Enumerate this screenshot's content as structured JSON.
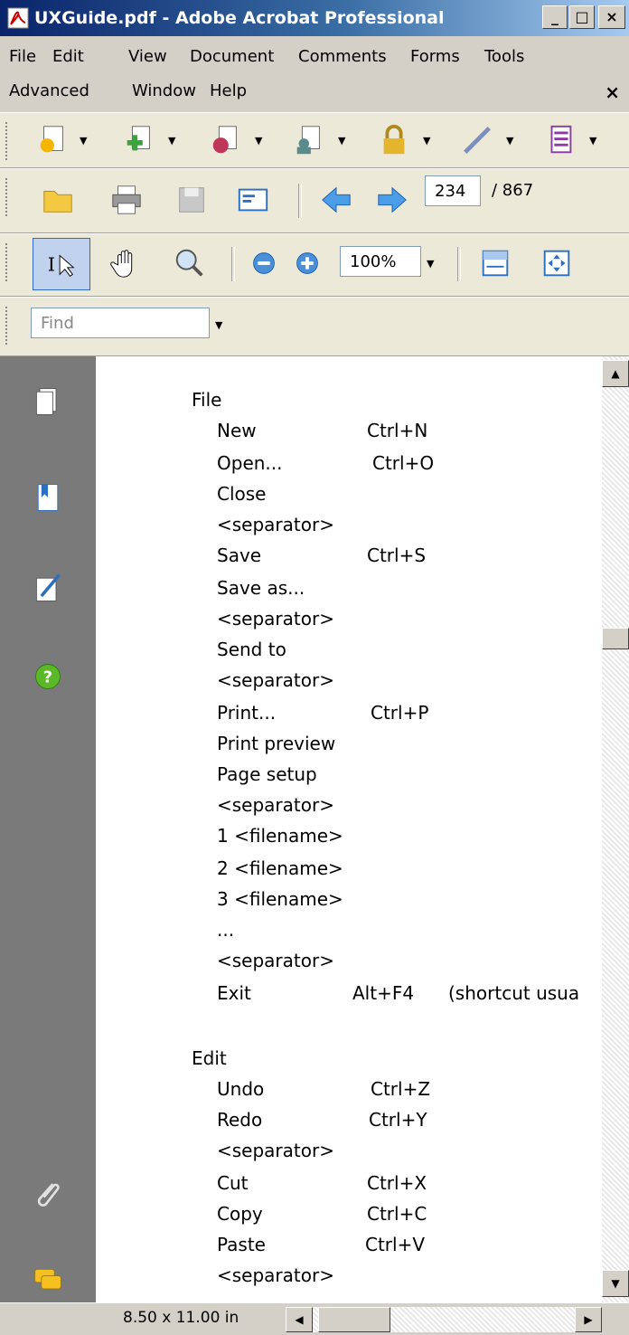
{
  "window": {
    "title": "UXGuide.pdf - Adobe Acrobat Professional",
    "minimize": "_",
    "maximize": "□",
    "close": "×"
  },
  "menu": {
    "items": [
      "File",
      "Edit",
      "View",
      "Document",
      "Comments",
      "Forms",
      "Tools",
      "Advanced",
      "Window",
      "Help"
    ],
    "close_doc": "×"
  },
  "toolbar": {
    "page_current": "234",
    "page_total": "/ 867",
    "zoom": "100%",
    "find_placeholder": "Find"
  },
  "document": {
    "lines": [
      "File",
      "New",
      "Ctrl+N",
      "Open...",
      "Ctrl+O",
      "Close",
      "<separator>",
      "Save",
      "Ctrl+S",
      "Save as...",
      "<separator>",
      "Send to",
      "<separator>",
      "Print...",
      "Ctrl+P",
      "Print preview",
      "Page setup",
      "<separator>",
      "1 <filename>",
      "2 <filename>",
      "3 <filename>",
      "...",
      "<separator>",
      "Exit",
      "Alt+F4",
      "(shortcut usua",
      "Edit",
      "Undo",
      "Ctrl+Z",
      "Redo",
      "Ctrl+Y",
      "<separator>",
      "Cut",
      "Ctrl+X",
      "Copy",
      "Ctrl+C",
      "Paste",
      "Ctrl+V",
      "<separator>"
    ]
  },
  "status": {
    "page_size": "8.50 x 11.00 in"
  }
}
